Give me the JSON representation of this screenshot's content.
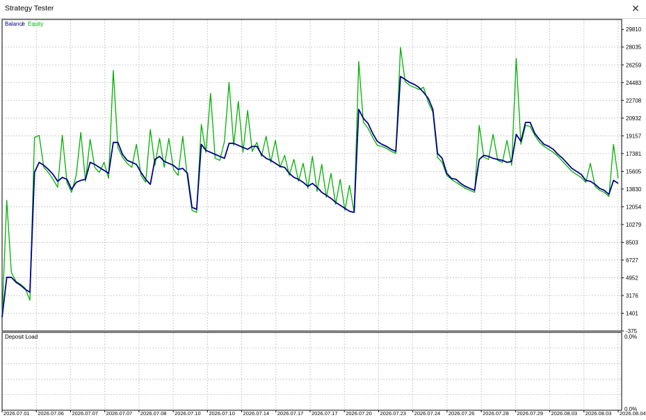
{
  "window": {
    "title": "Strategy Tester",
    "close_glyph": "✕"
  },
  "legend": {
    "balance": "Balance",
    "separator": " / ",
    "equity": "Equity"
  },
  "colors": {
    "balance": "#00008b",
    "equity": "#00b000",
    "grid": "#bfbfbf",
    "frame": "#000000"
  },
  "chart_data": [
    {
      "type": "line",
      "series": [
        {
          "name": "Balance",
          "values": [
            1000,
            5000,
            5000,
            4500,
            4200,
            3800,
            3500,
            15500,
            16500,
            16200,
            15800,
            15300,
            14600,
            15000,
            14800,
            13800,
            14500,
            14700,
            14800,
            16500,
            16300,
            16000,
            15700,
            15400,
            18500,
            18500,
            17300,
            16700,
            16500,
            16300,
            15500,
            14800,
            14300,
            16800,
            17100,
            16600,
            16400,
            16200,
            15800,
            15900,
            15400,
            12000,
            11800,
            18300,
            17700,
            17500,
            17300,
            17100,
            16900,
            18400,
            18400,
            18200,
            18000,
            17800,
            18100,
            18100,
            17300,
            16900,
            16700,
            16400,
            16100,
            16000,
            15400,
            15000,
            14800,
            14500,
            14100,
            14400,
            14000,
            13500,
            13200,
            12900,
            12500,
            12200,
            11900,
            11600,
            11500,
            21800,
            20900,
            20400,
            19400,
            18600,
            18300,
            18100,
            17800,
            17600,
            25100,
            24800,
            24500,
            24300,
            24000,
            23500,
            22900,
            21800,
            17400,
            16900,
            15400,
            14900,
            14800,
            14400,
            14100,
            13900,
            13700,
            16800,
            17200,
            17100,
            16900,
            16800,
            16700,
            16500,
            16600,
            19300,
            18600,
            20500,
            20500,
            19400,
            18800,
            18300,
            18100,
            17800,
            17300,
            16900,
            16400,
            15900,
            15600,
            15300,
            14700,
            14600,
            14300,
            13900,
            13700,
            13300,
            14700,
            14400
          ]
        },
        {
          "name": "Equity",
          "values": [
            1000,
            12700,
            5500,
            4600,
            4300,
            3900,
            2700,
            19000,
            19200,
            16000,
            15500,
            14800,
            14000,
            19200,
            14500,
            13500,
            15200,
            19500,
            14600,
            18800,
            16000,
            15500,
            16500,
            14900,
            25700,
            18000,
            17000,
            16400,
            16000,
            18300,
            15200,
            14500,
            19800,
            16200,
            18900,
            16000,
            18900,
            15800,
            15200,
            19100,
            15000,
            11700,
            11500,
            20300,
            17500,
            23400,
            16900,
            16700,
            18600,
            24500,
            18200,
            22600,
            17500,
            21700,
            17600,
            18500,
            17100,
            19100,
            16500,
            18700,
            16000,
            17200,
            15200,
            16800,
            14600,
            16400,
            13900,
            17100,
            13600,
            16300,
            13000,
            15400,
            12300,
            14800,
            11700,
            14200,
            11500,
            26600,
            20500,
            19900,
            19000,
            18200,
            18100,
            17900,
            17600,
            17400,
            28000,
            24600,
            24200,
            24000,
            23800,
            24000,
            22500,
            21500,
            17000,
            16500,
            15200,
            14800,
            14500,
            14200,
            13900,
            13700,
            13500,
            20200,
            17000,
            16800,
            19300,
            16700,
            16500,
            18700,
            16200,
            26900,
            18300,
            20200,
            20100,
            19200,
            18500,
            18100,
            17800,
            17500,
            17100,
            16600,
            16100,
            15600,
            15300,
            15000,
            14500,
            16400,
            14100,
            13700,
            13500,
            13100,
            18300,
            14900
          ]
        }
      ],
      "x": [
        "2026.07.01",
        "2026.07.06",
        "2026.07.07",
        "2026.07.07",
        "2026.07.08",
        "2026.07.10",
        "2026.07.10",
        "2026.07.14",
        "2026.07.17",
        "2026.07.17",
        "2026.07.20",
        "2026.07.23",
        "2026.07.24",
        "2026.07.26",
        "2026.07.28",
        "2026.07.29",
        "2026.08.03",
        "2026.08.03",
        "2026.08.04"
      ],
      "y_ticks": [
        "29810",
        "28035",
        "26259",
        "24483",
        "22708",
        "20932",
        "19157",
        "17381",
        "15605",
        "13830",
        "12054",
        "10279",
        "8503",
        "6727",
        "4952",
        "3176",
        "1401",
        "-375"
      ],
      "ylim": [
        -375,
        30800
      ],
      "grid": true
    },
    {
      "type": "line",
      "title": "Deposit Load",
      "y_ticks": [
        "0.0%",
        "0.0%"
      ],
      "values": [],
      "grid": true
    }
  ]
}
